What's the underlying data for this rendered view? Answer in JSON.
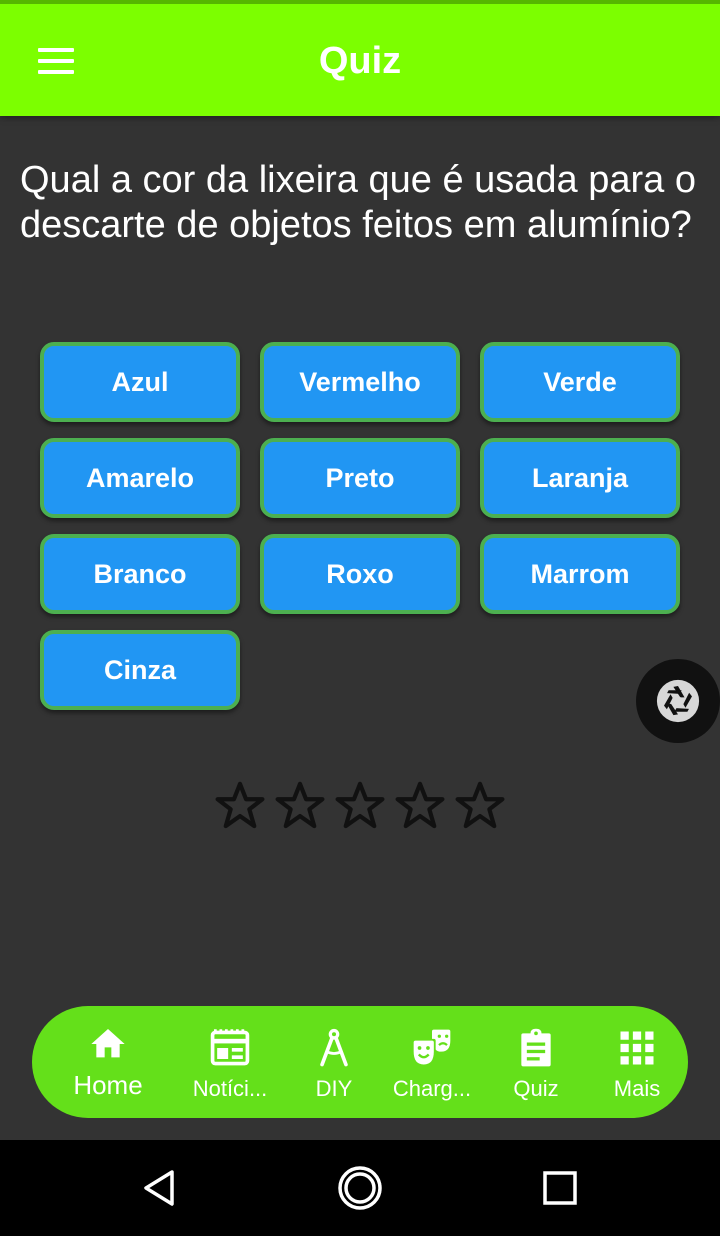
{
  "app_bar": {
    "title": "Quiz",
    "menu_icon": "hamburger-menu-icon",
    "color": "#7cff00"
  },
  "question": "Qual a cor da lixeira que é usada para o descarte de objetos feitos em alumínio?",
  "answers": [
    "Azul",
    "Vermelho",
    "Verde",
    "Amarelo",
    "Preto",
    "Laranja",
    "Branco",
    "Roxo",
    "Marrom",
    "Cinza"
  ],
  "rating": {
    "filled": 0,
    "max": 5,
    "icon": "star-outline-icon"
  },
  "floating_button": {
    "icon": "camera-shutter-icon"
  },
  "bottom_nav": {
    "items": [
      {
        "label": "Home",
        "icon": "home-icon",
        "active": true
      },
      {
        "label": "Notíci...",
        "icon": "newspaper-icon"
      },
      {
        "label": "DIY",
        "icon": "compass-tool-icon"
      },
      {
        "label": "Charg...",
        "icon": "theater-masks-icon"
      },
      {
        "label": "Quiz",
        "icon": "clipboard-icon"
      },
      {
        "label": "Mais",
        "icon": "grid-apps-icon"
      }
    ],
    "color": "#64e01a"
  },
  "system_nav": {
    "back_icon": "back-triangle-icon",
    "home_icon": "home-circle-icon",
    "recents_icon": "recents-square-icon"
  },
  "colors": {
    "background": "#333333",
    "answer_button": "#2196f3",
    "answer_border": "#4caf50"
  }
}
